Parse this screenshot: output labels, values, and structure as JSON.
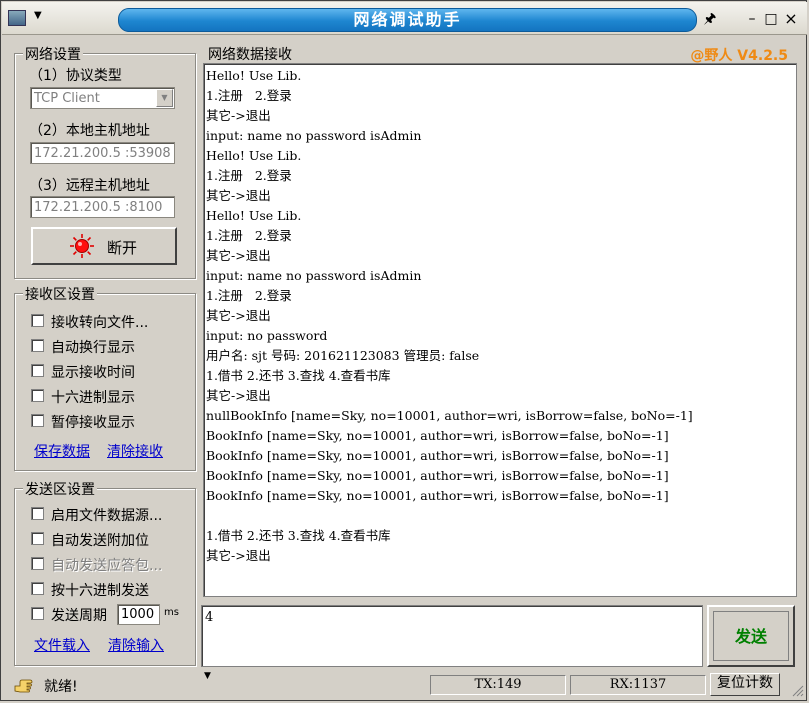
{
  "window": {
    "title": "网络调试助手",
    "version": "@野人 V4.2.5",
    "controls": {
      "pin": "🖈",
      "min": "–",
      "max": "□",
      "close": "×"
    }
  },
  "network_settings": {
    "title": "网络设置",
    "protocol_label": "（1）协议类型",
    "protocol_value": "TCP Client",
    "local_label": "（2）本地主机地址",
    "local_value": "172.21.200.5 :53908",
    "remote_label": "（3）远程主机地址",
    "remote_value": "172.21.200.5 :8100",
    "disconnect_label": "断开"
  },
  "receive_settings": {
    "title": "接收区设置",
    "options": [
      {
        "label": "接收转向文件...",
        "checked": false,
        "disabled": false
      },
      {
        "label": "自动换行显示",
        "checked": false,
        "disabled": false
      },
      {
        "label": "显示接收时间",
        "checked": false,
        "disabled": false
      },
      {
        "label": "十六进制显示",
        "checked": false,
        "disabled": false
      },
      {
        "label": "暂停接收显示",
        "checked": false,
        "disabled": false
      }
    ],
    "save_link": "保存数据",
    "clear_link": "清除接收"
  },
  "send_settings": {
    "title": "发送区设置",
    "options": [
      {
        "label": "启用文件数据源...",
        "checked": false,
        "disabled": false
      },
      {
        "label": "自动发送附加位",
        "checked": false,
        "disabled": false
      },
      {
        "label": "自动发送应答包...",
        "checked": false,
        "disabled": true
      },
      {
        "label": "按十六进制发送",
        "checked": false,
        "disabled": false
      }
    ],
    "period_label": "发送周期",
    "period_value": "1000",
    "period_unit": "ms",
    "load_link": "文件载入",
    "clear_link": "清除输入"
  },
  "receive_area": {
    "title": "网络数据接收",
    "lines": [
      "Hello! Use Lib.",
      "1.注册   2.登录",
      "其它->退出",
      "input: name no password isAdmin",
      "Hello! Use Lib.",
      "1.注册   2.登录",
      "其它->退出",
      "Hello! Use Lib.",
      "1.注册   2.登录",
      "其它->退出",
      "input: name no password isAdmin",
      "1.注册   2.登录",
      "其它->退出",
      "input: no password",
      "用户名: sjt 号码: 201621123083 管理员: false",
      "1.借书 2.还书 3.查找 4.查看书库",
      "其它->退出",
      "nullBookInfo [name=Sky, no=10001, author=wri, isBorrow=false, boNo=-1]",
      "BookInfo [name=Sky, no=10001, author=wri, isBorrow=false, boNo=-1]",
      "BookInfo [name=Sky, no=10001, author=wri, isBorrow=false, boNo=-1]",
      "BookInfo [name=Sky, no=10001, author=wri, isBorrow=false, boNo=-1]",
      "BookInfo [name=Sky, no=10001, author=wri, isBorrow=false, boNo=-1]",
      "",
      "1.借书 2.还书 3.查找 4.查看书库",
      "其它->退出"
    ]
  },
  "send_area": {
    "input_value": "4",
    "send_label": "发送"
  },
  "status_bar": {
    "status_text": "就绪!",
    "tx": "TX:149",
    "rx": "RX:1137",
    "reset_label": "复位计数"
  }
}
